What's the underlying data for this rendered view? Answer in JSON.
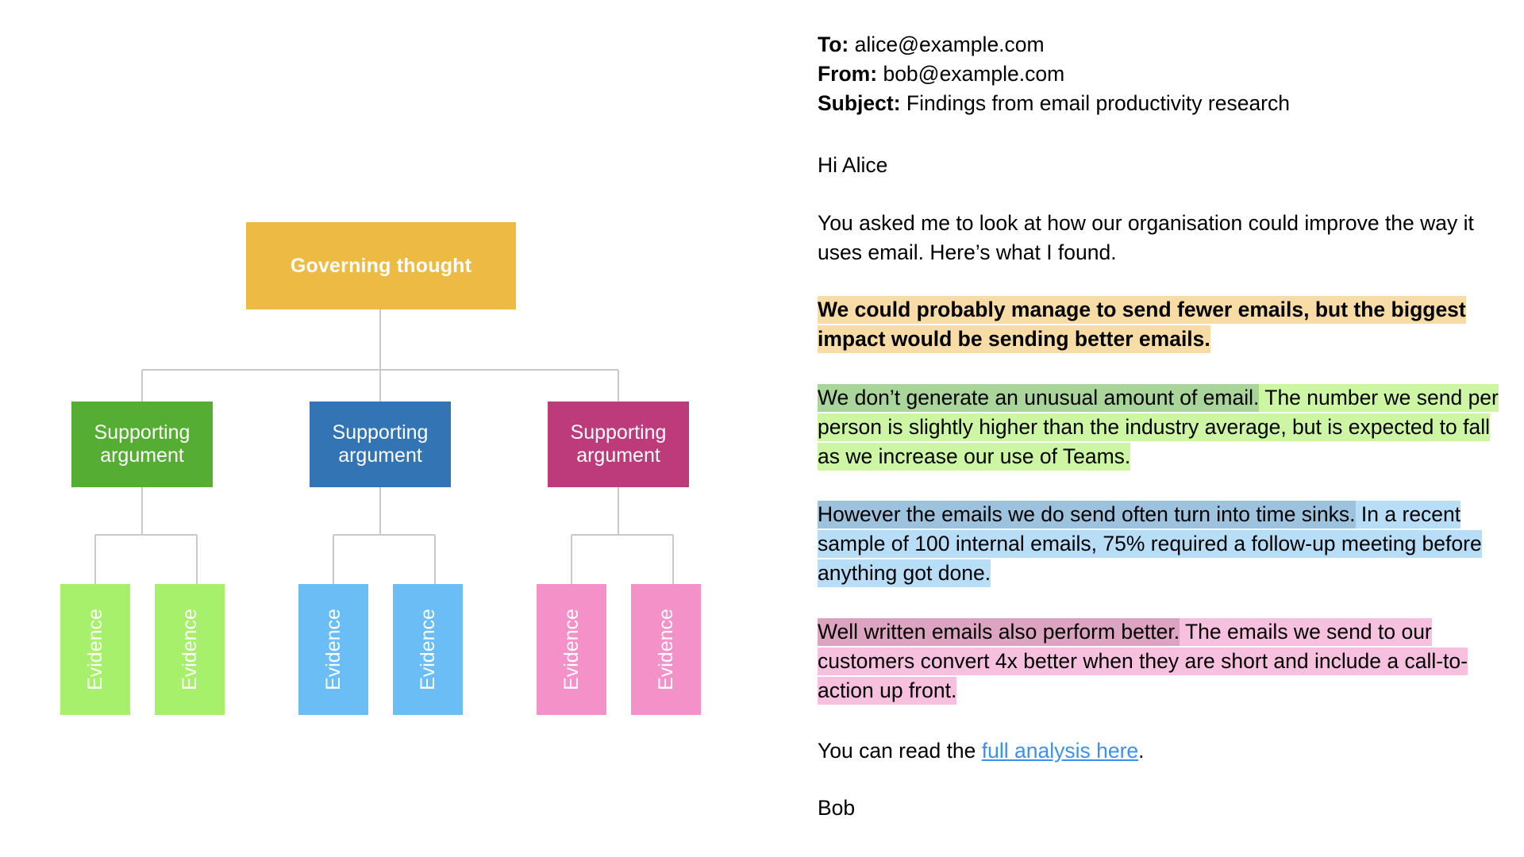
{
  "diagram": {
    "title_node": {
      "label": "Governing thought",
      "color": "#edbb44",
      "text_color": "#ffffff"
    },
    "connector_color": "#c9c9c9",
    "branches": [
      {
        "argument": {
          "label": "Supporting argument",
          "color": "#55ae33"
        },
        "evidence": [
          {
            "label": "Evidence",
            "color": "#a6f06b"
          },
          {
            "label": "Evidence",
            "color": "#a6f06b"
          }
        ]
      },
      {
        "argument": {
          "label": "Supporting argument",
          "color": "#3274b4"
        },
        "evidence": [
          {
            "label": "Evidence",
            "color": "#6bbdf5"
          },
          {
            "label": "Evidence",
            "color": "#6bbdf5"
          }
        ]
      },
      {
        "argument": {
          "label": "Supporting argument",
          "color": "#bd3a7b"
        },
        "evidence": [
          {
            "label": "Evidence",
            "color": "#f391c8"
          },
          {
            "label": "Evidence",
            "color": "#f391c8"
          }
        ]
      }
    ]
  },
  "email": {
    "headers": {
      "to_label": "To:",
      "to_value": "alice@example.com",
      "from_label": "From:",
      "from_value": "bob@example.com",
      "subject_label": "Subject:",
      "subject_value": "Findings from email productivity research"
    },
    "greeting": "Hi Alice",
    "intro": "You asked me to look at how our organisation could improve the way it uses email. Here’s what I found.",
    "paragraphs": [
      {
        "key_sentence": "We could probably manage to send fewer emails, but the biggest impact would be sending better emails.",
        "rest": "",
        "key_color": "#f7dca6",
        "rest_color": "#f7dca6",
        "bold": true
      },
      {
        "key_sentence": "We don’t generate an unusual amount of email.",
        "rest": " The number we send per person is slightly higher than the industry average, but is expected to fall as we increase our use of Teams.",
        "key_color": "#a9d49a",
        "rest_color": "#ccf6a4",
        "bold": false
      },
      {
        "key_sentence": "However the emails we do send often turn into time sinks.",
        "rest": " In a recent sample of 100 internal emails, 75% required a follow-up meeting before anything got done.",
        "key_color": "#9dc2dd",
        "rest_color": "#b8ddf7",
        "bold": false
      },
      {
        "key_sentence": "Well written emails also perform better.",
        "rest": " The emails we send to our customers convert 4x better when they are short and include a call-to-action up front.",
        "key_color": "#dca4c0",
        "rest_color": "#f7c0de",
        "bold": false
      }
    ],
    "closing": {
      "prefix": "You can read the ",
      "link_text": "full analysis here",
      "suffix": ".",
      "link_color": "#3b90f5"
    },
    "signature": "Bob"
  }
}
